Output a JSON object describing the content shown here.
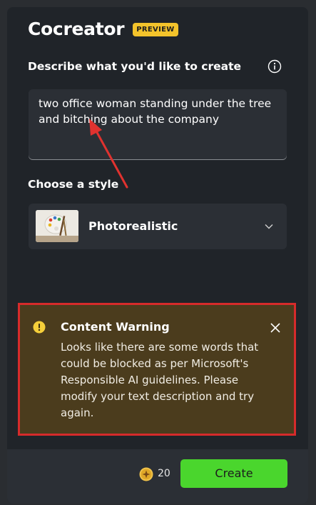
{
  "header": {
    "title": "Cocreator",
    "badge": "PREVIEW"
  },
  "prompt": {
    "label": "Describe what you'd like to create",
    "value": "two office woman standing under the tree and bitching about the company",
    "info_icon": "info-icon"
  },
  "style": {
    "label": "Choose a style",
    "selected": "Photorealistic",
    "thumbnail_icon": "palette-icon"
  },
  "warning": {
    "title": "Content Warning",
    "message": "Looks like there are some words that could be blocked as per Microsoft's Responsible AI guidelines. Please modify your text description and try again.",
    "icon": "exclamation-icon",
    "close_icon": "close-icon"
  },
  "footer": {
    "credits": "20",
    "create_label": "Create"
  },
  "colors": {
    "badge": "#f3c32b",
    "warning_bg": "#4b3c1d",
    "highlight_border": "#d62b2b",
    "create_button": "#4ad62d",
    "annotation_arrow": "#e0322f"
  }
}
